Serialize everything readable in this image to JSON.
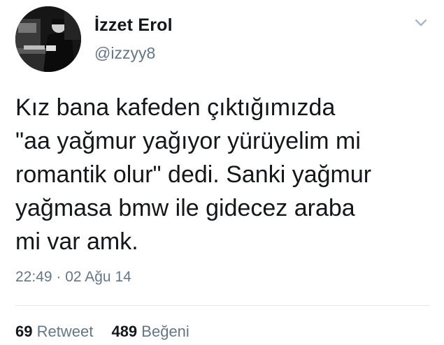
{
  "author": {
    "display_name": "İzzet Erol",
    "handle": "@izzyy8"
  },
  "tweet": {
    "text": "Kız bana kafeden çıktığımızda\n\"aa yağmur yağıyor yürüyelim mi\nromantik olur\" dedi. Sanki yağmur\nyağmasa bmw ile gidecez araba\nmi var amk.",
    "timestamp": "22:49 · 02 Ağu 14"
  },
  "stats": {
    "retweets_count": "69",
    "retweets_label": "Retweet",
    "likes_count": "489",
    "likes_label": "Beğeni"
  },
  "icons": {
    "menu": "chevron-down-icon"
  },
  "colors": {
    "text_primary": "#14171a",
    "text_secondary": "#657786",
    "divider": "#e1e8ed"
  }
}
